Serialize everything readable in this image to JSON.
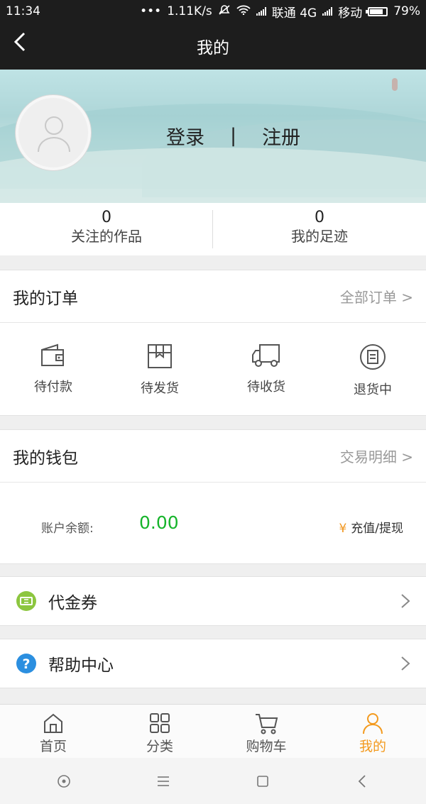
{
  "status_bar": {
    "time": "11:34",
    "dots": "•••",
    "speed": "1.11K/s",
    "carrier1": "联通 4G",
    "carrier2": "移动",
    "battery": "79%"
  },
  "nav": {
    "title": "我的"
  },
  "profile": {
    "login_label": "登录",
    "separator": "|",
    "register_label": "注册"
  },
  "stats": [
    {
      "value": "0",
      "label": "关注的作品"
    },
    {
      "value": "0",
      "label": "我的足迹"
    }
  ],
  "orders": {
    "title": "我的订单",
    "link": "全部订单 >",
    "items": [
      {
        "label": "待付款",
        "icon": "wallet-icon"
      },
      {
        "label": "待发货",
        "icon": "box-icon"
      },
      {
        "label": "待收货",
        "icon": "truck-icon"
      },
      {
        "label": "退货中",
        "icon": "return-icon"
      }
    ]
  },
  "wallet": {
    "title": "我的钱包",
    "link": "交易明细 >",
    "balance_label": "账户余额:",
    "balance_value": "0.00",
    "recharge_symbol": "¥",
    "recharge_label": "充值/提现",
    "balance_color": "#16b42b"
  },
  "menu": [
    {
      "label": "代金券",
      "icon": "voucher-icon",
      "color": "#8cc63f"
    },
    {
      "label": "帮助中心",
      "icon": "help-icon",
      "color": "#2b8fe0"
    }
  ],
  "tabs": [
    {
      "label": "首页",
      "icon": "home-icon"
    },
    {
      "label": "分类",
      "icon": "category-icon"
    },
    {
      "label": "购物车",
      "icon": "cart-icon"
    },
    {
      "label": "我的",
      "icon": "user-icon",
      "active": true
    }
  ],
  "accent_color": "#f39a1e"
}
